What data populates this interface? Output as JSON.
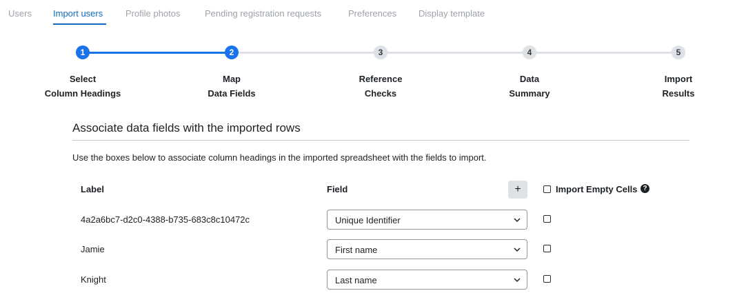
{
  "tabs": [
    {
      "label": "Users",
      "active": false
    },
    {
      "label": "Import users",
      "active": true
    },
    {
      "label": "Profile photos",
      "active": false
    },
    {
      "label": "Pending registration requests",
      "active": false
    },
    {
      "label": "Preferences",
      "active": false
    },
    {
      "label": "Display template",
      "active": false
    }
  ],
  "stepper": {
    "current_step": 2,
    "steps": [
      {
        "number": "1",
        "line1": "Select",
        "line2": "Column Headings"
      },
      {
        "number": "2",
        "line1": "Map",
        "line2": "Data Fields"
      },
      {
        "number": "3",
        "line1": "Reference",
        "line2": "Checks"
      },
      {
        "number": "4",
        "line1": "Data",
        "line2": "Summary"
      },
      {
        "number": "5",
        "line1": "Import",
        "line2": "Results"
      }
    ]
  },
  "section": {
    "title": "Associate data fields with the imported rows",
    "description": "Use the boxes below to associate column headings in the imported spreadsheet with the fields to import."
  },
  "table": {
    "label_header": "Label",
    "field_header": "Field",
    "add_button": "+",
    "import_empty_label": "Import Empty Cells",
    "help_icon": "?",
    "rows": [
      {
        "label": "4a2a6bc7-d2c0-4388-b735-683c8c10472c",
        "field": "Unique Identifier",
        "checked": false
      },
      {
        "label": "Jamie",
        "field": "First name",
        "checked": false
      },
      {
        "label": "Knight",
        "field": "Last name",
        "checked": false
      }
    ]
  },
  "colors": {
    "accent": "#0f6cbf",
    "step_active": "#1a73e8",
    "step_inactive": "#dee2e6",
    "tab_inactive": "#9ea3a8"
  }
}
